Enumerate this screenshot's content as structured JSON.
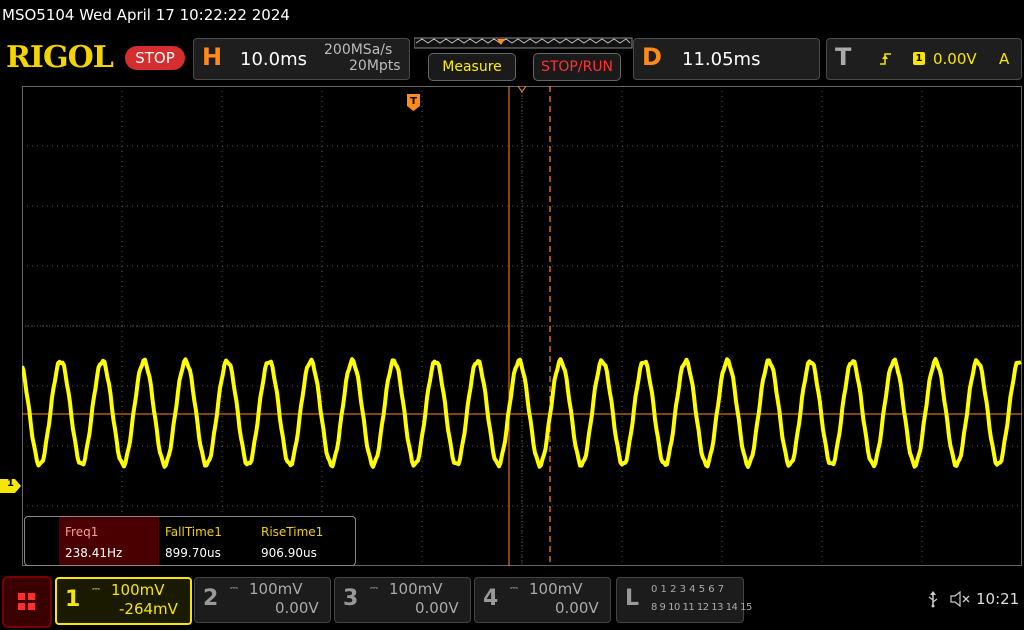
{
  "header": {
    "model_datetime": "MSO5104  Wed April 17 10:22:22 2024",
    "logo": "RIGOL",
    "run_state": "STOP",
    "horizontal": {
      "letter": "H",
      "timebase": "10.0ms",
      "sample_rate": "200MSa/s",
      "memory_depth": "20Mpts"
    },
    "measure_label": "Measure",
    "stop_run_label": "STOP/RUN",
    "delay": {
      "letter": "D",
      "value": "11.05ms"
    },
    "trigger": {
      "letter": "T",
      "source": "1",
      "level": "0.00V",
      "mode": "A"
    }
  },
  "waveform": {
    "channel_marker": "1",
    "trigger_marker": "T",
    "color": "#ffff00",
    "cycles_visible": 24
  },
  "measurements": [
    {
      "label": "Freq1",
      "value": "238.41Hz"
    },
    {
      "label": "FallTime1",
      "value": "899.70us"
    },
    {
      "label": "RiseTime1",
      "value": "906.90us"
    }
  ],
  "channels": [
    {
      "num": "1",
      "scale": "100mV",
      "offset": "-264mV",
      "active": true
    },
    {
      "num": "2",
      "scale": "100mV",
      "offset": "0.00V",
      "active": false
    },
    {
      "num": "3",
      "scale": "100mV",
      "offset": "0.00V",
      "active": false
    },
    {
      "num": "4",
      "scale": "100mV",
      "offset": "0.00V",
      "active": false
    }
  ],
  "logic": {
    "letter": "L",
    "row1": "0 1 2 3  4 5 6 7",
    "row2": "8 9 10 11 12 13 14 15"
  },
  "status": {
    "usb_icon": "usb-icon",
    "sound_icon": "mute-icon",
    "clock": "10:21"
  },
  "colors": {
    "ch1": "#f7e600",
    "accent_orange": "#ff8c1a",
    "stop_red": "#d52e2e"
  }
}
